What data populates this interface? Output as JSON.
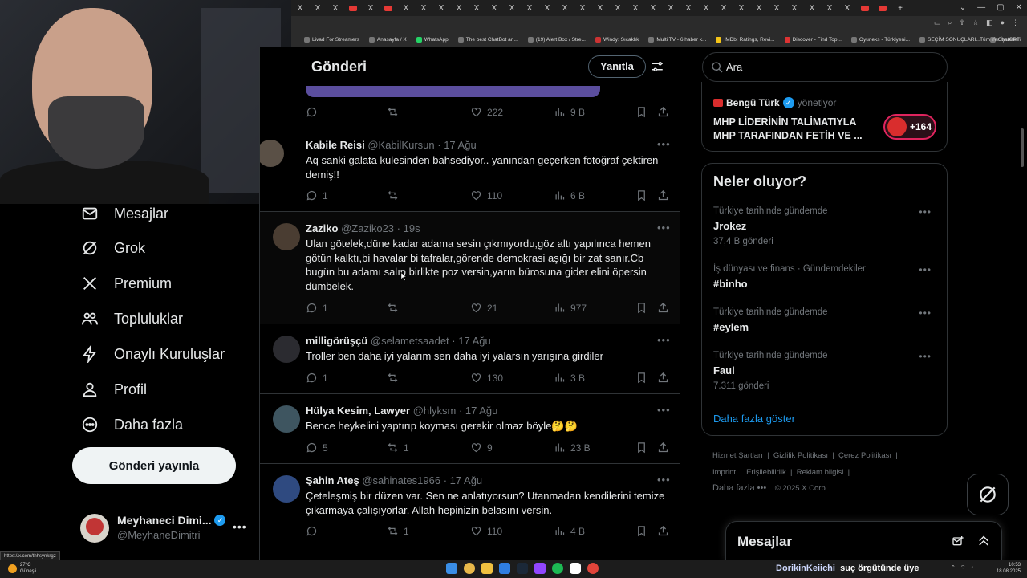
{
  "browser": {
    "tab_close_glyph": "X",
    "new_tab_glyph": "+",
    "window_controls": [
      "⌄",
      "—",
      "▢",
      "✕"
    ],
    "bookmarks": [
      "Livad For Streamers",
      "Anasayfa / X",
      "WhatsApp",
      "The best ChatBot an...",
      "(19) Alert Box / Stre...",
      "Windy: Sıcaklık",
      "Multi TV - 6 haber k...",
      "IMDb: Ratings, Revi...",
      "Discover - Find Top...",
      "Oyuneks - Türkiyeni...",
      "SEÇİM SONUÇLARI...",
      "ChatGPT"
    ],
    "bookmarks_folder": "Tüm Yer İşaretleri"
  },
  "sidebar": {
    "items": [
      {
        "label": "Mesajlar",
        "icon": "envelope-icon"
      },
      {
        "label": "Grok",
        "icon": "grok-icon"
      },
      {
        "label": "Premium",
        "icon": "x-logo-icon"
      },
      {
        "label": "Topluluklar",
        "icon": "communities-icon"
      },
      {
        "label": "Onaylı Kuruluşlar",
        "icon": "lightning-icon"
      },
      {
        "label": "Profil",
        "icon": "person-icon"
      },
      {
        "label": "Daha fazla",
        "icon": "more-circle-icon"
      }
    ],
    "post_button": "Gönderi yayınla",
    "account": {
      "name": "Meyhaneci Dimi...",
      "handle": "@MeyhaneDimitri",
      "more": "•••"
    },
    "status_url": "https://x.com/thhsynkrgz"
  },
  "main": {
    "title": "Gönderi",
    "reply_button": "Yanıtla",
    "top_actions": {
      "likes": "222",
      "views": "9 B"
    },
    "tweets": [
      {
        "name": "Kabile Reisi",
        "handle": "@KabilKursun",
        "time": "17 Ağu",
        "text": "Aq sanki galata kulesinden bahsediyor.. yanından geçerken fotoğraf çektiren demiş!!",
        "replies": "1",
        "retweets": "",
        "likes": "110",
        "views": "6 B"
      },
      {
        "name": "Zaziko",
        "handle": "@Zaziko23",
        "time": "19s",
        "text": "Ulan götelek,düne kadar adama sesin çıkmıyordu,göz altı yapılınca hemen götün kalktı,bi havalar bi tafralar,görende demokrasi aşığı bir zat sanır.Cb bugün bu adamı salıp birlikte poz versin,yarın bürosuna gider elini öpersin dümbelek.",
        "replies": "1",
        "retweets": "",
        "likes": "21",
        "views": "977"
      },
      {
        "name": "milligörüşçü",
        "handle": "@selametsaadet",
        "time": "17 Ağu",
        "text": "Troller ben daha iyi yalarım sen daha iyi yalarsın yarışına girdiler",
        "replies": "1",
        "retweets": "",
        "likes": "130",
        "views": "3 B"
      },
      {
        "name": "Hülya Kesim, Lawyer",
        "handle": "@hlyksm",
        "time": "17 Ağu",
        "text": "Bence heykelini yaptırıp koyması gerekir olmaz böyle🤔🤔",
        "replies": "5",
        "retweets": "1",
        "likes": "9",
        "views": "23 B"
      },
      {
        "name": "Şahin Ateş",
        "handle": "@sahinates1966",
        "time": "17 Ağu",
        "text": "Çeteleşmiş bir düzen var. Sen ne anlatıyorsun? Utanmadan kendilerini temize çıkarmaya çalışıyorlar. Allah hepinizin belasını versin.",
        "replies": "",
        "retweets": "1",
        "likes": "110",
        "views": "4 B"
      }
    ]
  },
  "right": {
    "search_placeholder": "Ara",
    "promo": {
      "brand": "Bengü Türk",
      "sub": "yönetiyor",
      "title": "MHP LİDERİNİN TALİMATIYLA MHP TARAFINDAN FETİH VE ...",
      "badge": "+164"
    },
    "trends_title": "Neler oluyor?",
    "trends": [
      {
        "context": "Türkiye tarihinde gündemde",
        "name": "Jrokez",
        "count": "37,4 B gönderi"
      },
      {
        "context": "İş dünyası ve finans · Gündemdekiler",
        "name": "#binho",
        "count": ""
      },
      {
        "context": "Türkiye tarihinde gündemde",
        "name": "#eylem",
        "count": ""
      },
      {
        "context": "Türkiye tarihinde gündemde",
        "name": "Faul",
        "count": "7.311 gönderi"
      }
    ],
    "show_more": "Daha fazla göster",
    "footer": {
      "row1": [
        "Hizmet Şartları",
        "Gizlilik Politikası",
        "Çerez Politikası"
      ],
      "row2": [
        "Imprint",
        "Erişilebilirlik",
        "Reklam bilgisi"
      ],
      "row3_more": "Daha fazla •••",
      "copyright": "© 2025 X Corp."
    },
    "messages_drawer": "Mesajlar"
  },
  "taskbar": {
    "weather_temp": "27°C",
    "weather_desc": "Güneşli",
    "notification_name": "DorikinKeiichi",
    "notification_text": "suç örgütünde üye",
    "time": "10:53",
    "date": "18.08.2025"
  },
  "colors": {
    "accent": "#1d9bf0",
    "bg": "#000000",
    "border": "#2f3336",
    "muted": "#71767b"
  }
}
